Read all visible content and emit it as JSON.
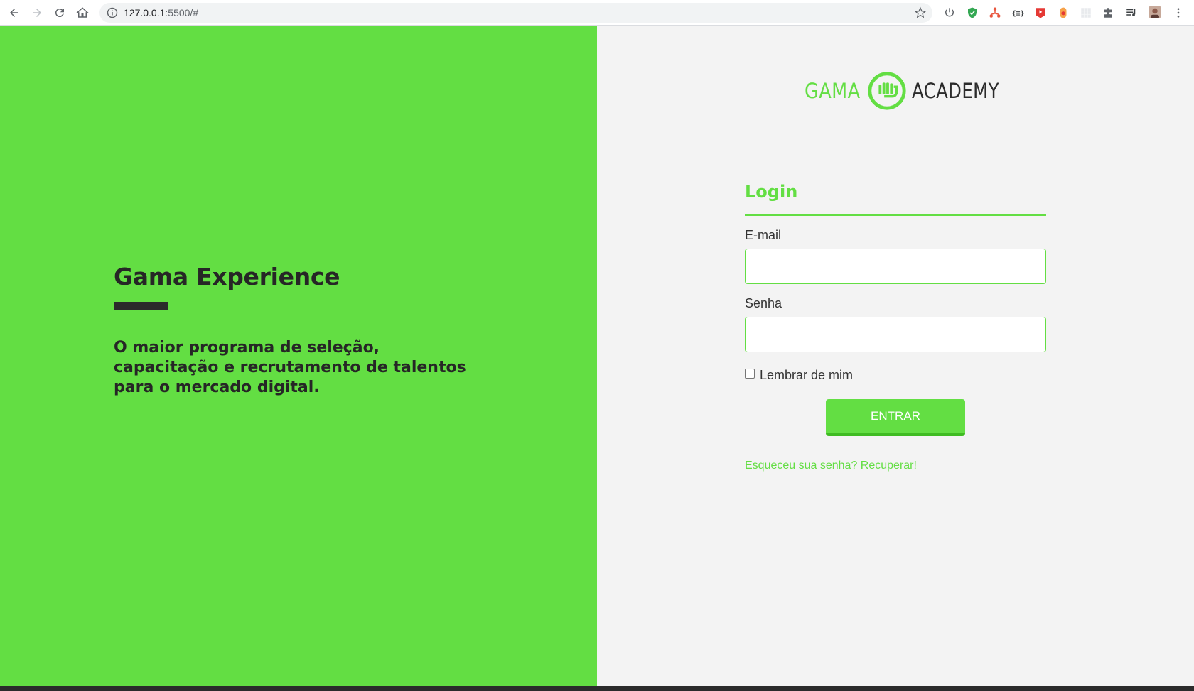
{
  "browser": {
    "url_host": "127.0.0.1",
    "url_path": ":5500/#",
    "icons": [
      "back-icon",
      "forward-icon",
      "reload-icon",
      "home-icon",
      "info-icon",
      "star-icon",
      "power-icon",
      "shield-icon",
      "network-icon",
      "braces-icon",
      "youtube-icon",
      "recorder-icon",
      "grid-icon",
      "puzzle-icon",
      "playlist-icon",
      "profile-avatar",
      "menu-icon"
    ]
  },
  "hero": {
    "title": "Gama Experience",
    "description": "O maior programa de seleção, capacitação e recrutamento de talentos para o mercado digital."
  },
  "logo": {
    "left_text": "GAMA",
    "right_text": "ACADEMY"
  },
  "login": {
    "title": "Login",
    "email_label": "E-mail",
    "email_value": "",
    "password_label": "Senha",
    "password_value": "",
    "remember_label": "Lembrar de mim",
    "remember_checked": false,
    "submit_label": "ENTRAR",
    "forgot_link": "Esqueceu sua senha? Recuperar!"
  },
  "colors": {
    "brand_green": "#63de43",
    "dark_text": "#262626",
    "panel_bg": "#f3f3f3"
  }
}
